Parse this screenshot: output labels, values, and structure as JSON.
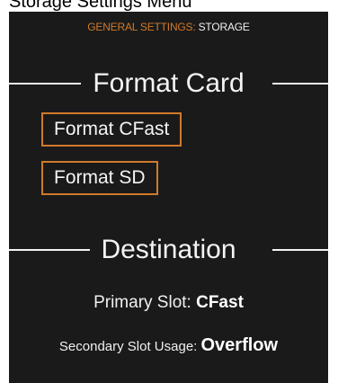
{
  "page": {
    "title": "Storage Settings Menu"
  },
  "header": {
    "breadcrumb_section": "GENERAL SETTINGS:",
    "breadcrumb_page": "STORAGE"
  },
  "format_card": {
    "title": "Format Card",
    "buttons": [
      {
        "label": "Format CFast"
      },
      {
        "label": "Format SD"
      }
    ]
  },
  "destination": {
    "title": "Destination",
    "primary_slot_label": "Primary Slot:",
    "primary_slot_value": "CFast",
    "secondary_usage_label": "Secondary Slot Usage:",
    "secondary_usage_value": "Overflow"
  },
  "colors": {
    "accent": "#d17a2b",
    "background": "#1a1a1a",
    "text": "#f4f4f4"
  }
}
